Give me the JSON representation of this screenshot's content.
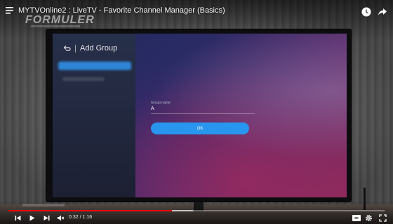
{
  "video": {
    "title": "MYTVOnline2 : LiveTV - Favorite Channel Manager (Basics)",
    "current_time": "0:32",
    "separator": "/",
    "duration": "1:16",
    "progress_fraction": 0.435,
    "buffer_fraction": 0.49,
    "cc_label": "cc"
  },
  "tv_ui": {
    "brand": "FORMULER",
    "header_title": "Add Group",
    "field_label": "Group name",
    "field_value": "A",
    "ok_label": "OK"
  },
  "icons": {
    "menu": "menu-icon",
    "watch_later": "clock-icon",
    "share": "share-icon",
    "back": "back-arrow-icon",
    "prev": "skip-previous-icon",
    "play": "play-icon",
    "next": "skip-next-icon",
    "mute": "volume-muted-icon",
    "settings": "gear-icon",
    "fullscreen": "fullscreen-icon"
  },
  "colors": {
    "progress": "#ff0000",
    "ok_button": "#2896ee",
    "side_active": "#2f86d6"
  }
}
